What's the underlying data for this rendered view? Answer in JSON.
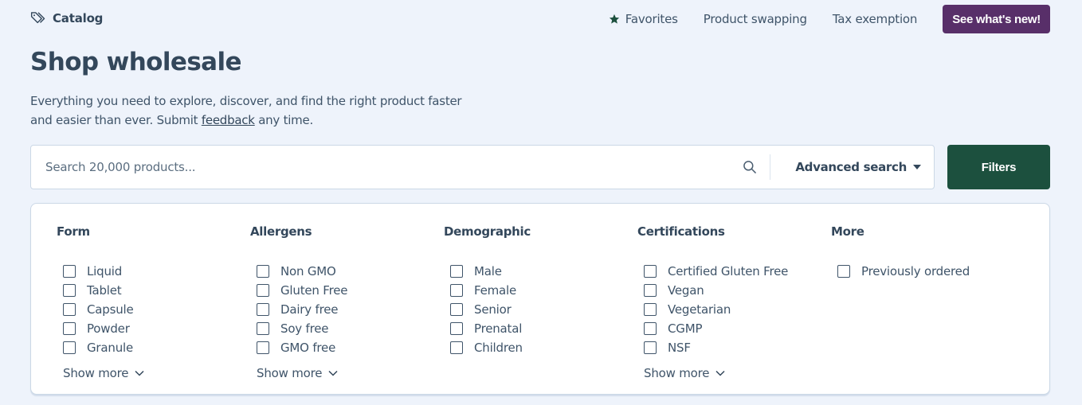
{
  "header": {
    "breadcrumb": "Catalog",
    "nav": [
      {
        "label": "Favorites",
        "icon": "star-icon"
      },
      {
        "label": "Product swapping"
      },
      {
        "label": "Tax exemption"
      }
    ],
    "cta_label": "See what's new!"
  },
  "page": {
    "title": "Shop wholesale",
    "subtitle_before": "Everything you need to explore, discover, and find the right product faster and easier than ever. Submit ",
    "subtitle_link": "feedback",
    "subtitle_after": " any time."
  },
  "search": {
    "placeholder": "Search 20,000 products...",
    "value": "",
    "advanced_label": "Advanced search",
    "filters_label": "Filters"
  },
  "filters": {
    "show_more_label": "Show more",
    "groups": [
      {
        "title": "Form",
        "options": [
          "Liquid",
          "Tablet",
          "Capsule",
          "Powder",
          "Granule"
        ],
        "show_more": true
      },
      {
        "title": "Allergens",
        "options": [
          "Non GMO",
          "Gluten Free",
          "Dairy free",
          "Soy free",
          "GMO free"
        ],
        "show_more": true
      },
      {
        "title": "Demographic",
        "options": [
          "Male",
          "Female",
          "Senior",
          "Prenatal",
          "Children"
        ],
        "show_more": false
      },
      {
        "title": "Certifications",
        "options": [
          "Certified Gluten Free",
          "Vegan",
          "Vegetarian",
          "CGMP",
          "NSF"
        ],
        "show_more": true
      },
      {
        "title": "More",
        "options": [
          "Previously ordered"
        ],
        "show_more": false
      }
    ]
  },
  "colors": {
    "background": "#eef3fb",
    "text": "#33475b",
    "cta_purple": "#582f69",
    "filters_green": "#1c503e",
    "star_green": "#1c503e"
  }
}
